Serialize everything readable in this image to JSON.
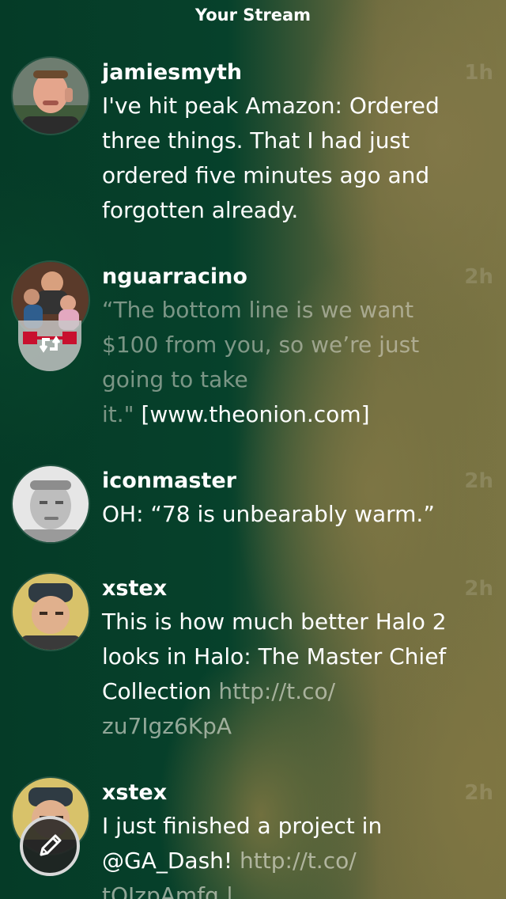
{
  "header": {
    "title": "Your Stream"
  },
  "posts": [
    {
      "username": "jamiesmyth",
      "time": "1h",
      "lines": [
        "I've hit peak Amazon: Ordered",
        "three things. That I had just",
        "ordered five minutes ago and",
        "forgotten already."
      ]
    },
    {
      "username": "nguarracino",
      "time": "2h",
      "lines": [
        "“The bottom line is we want",
        "$100 from you, so we’re just",
        "going to take"
      ],
      "last_line_muted": "it.\"",
      "last_line_rest": " [www.theonion.com]"
    },
    {
      "username": "iconmaster",
      "time": "2h",
      "lines": [
        "OH: “78 is unbearably warm.”"
      ]
    },
    {
      "username": "xstex",
      "time": "2h",
      "lines": [
        "This is how much better Halo 2",
        "looks in Halo: The Master Chief"
      ],
      "line3_text": "Collection ",
      "line3_link": "http://t.co/",
      "line4_link": "zu7Igz6KpA"
    },
    {
      "username": "xstex",
      "time": "2h",
      "lines": [
        "I just finished a project in"
      ],
      "line2_text": "@GA_Dash! ",
      "line2_link": "http://t.co/",
      "line3_link": "tQJzpAmfq |"
    }
  ],
  "icons": {
    "compose": "pencil-icon",
    "repost": "repost-icon"
  },
  "colors": {
    "bg_green": "#063a28",
    "bg_olive": "#7a7443",
    "text": "#ffffff"
  }
}
